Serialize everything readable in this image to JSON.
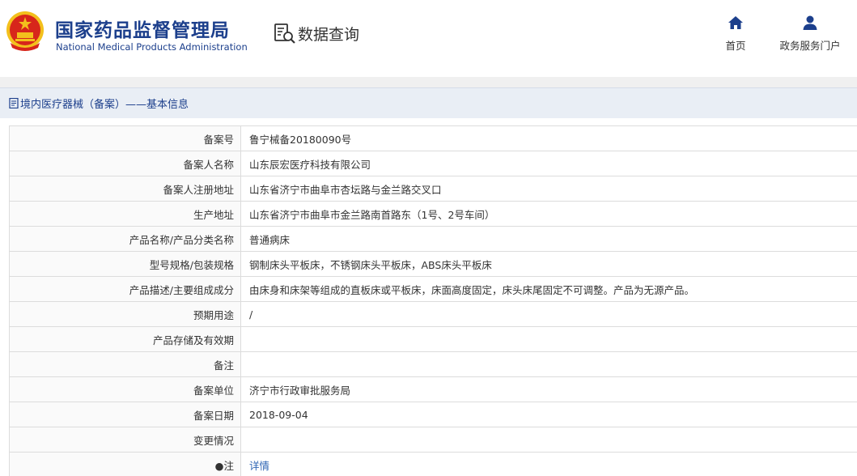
{
  "header": {
    "agency_cn": "国家药品监督管理局",
    "agency_en": "National Medical Products Administration",
    "query_label": "数据查询",
    "nav": [
      {
        "label": "首页",
        "icon": "home-icon"
      },
      {
        "label": "政务服务门户",
        "icon": "user-icon"
      }
    ]
  },
  "section": {
    "title": "境内医疗器械（备案）——基本信息",
    "icon": "document-icon"
  },
  "rows": [
    {
      "label": "备案号",
      "value": "鲁宁械备20180090号"
    },
    {
      "label": "备案人名称",
      "value": "山东辰宏医疗科技有限公司"
    },
    {
      "label": "备案人注册地址",
      "value": "山东省济宁市曲阜市杏坛路与金兰路交叉口"
    },
    {
      "label": "生产地址",
      "value": "山东省济宁市曲阜市金兰路南首路东（1号、2号车间）"
    },
    {
      "label": "产品名称/产品分类名称",
      "value": "普通病床"
    },
    {
      "label": "型号规格/包装规格",
      "value": "钢制床头平板床，不锈钢床头平板床，ABS床头平板床"
    },
    {
      "label": "产品描述/主要组成成分",
      "value": "由床身和床架等组成的直板床或平板床，床面高度固定，床头床尾固定不可调整。产品为无源产品。"
    },
    {
      "label": "预期用途",
      "value": "/"
    },
    {
      "label": "产品存储及有效期",
      "value": ""
    },
    {
      "label": "备注",
      "value": ""
    },
    {
      "label": "备案单位",
      "value": "济宁市行政审批服务局"
    },
    {
      "label": "备案日期",
      "value": "2018-09-04"
    },
    {
      "label": "变更情况",
      "value": ""
    },
    {
      "label": "●注",
      "value": "详情"
    }
  ],
  "colors": {
    "brand_blue": "#1c3f8c",
    "link_blue": "#2d64b3",
    "emblem_red": "#d7261b",
    "emblem_gold": "#f3c01c"
  }
}
